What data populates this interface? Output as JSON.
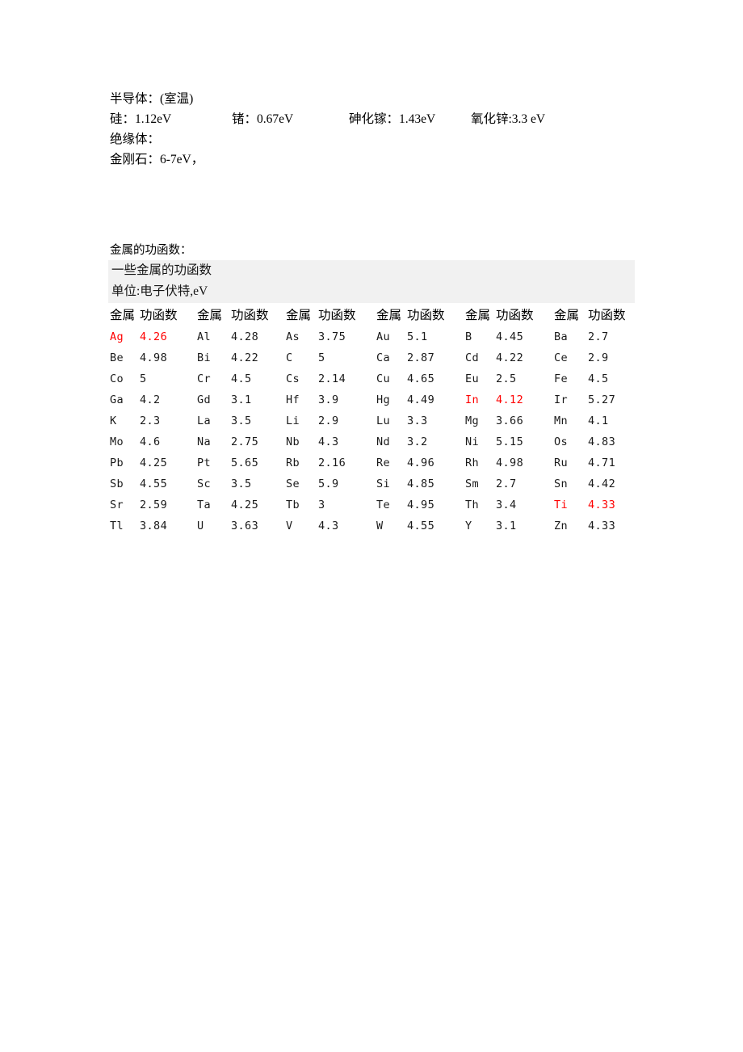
{
  "document": {
    "semiconductor": {
      "heading": "半导体：(室温)",
      "entries": [
        "硅：1.12eV",
        "锗：0.67eV",
        "砷化镓：1.43eV",
        "氧化锌:3.3 eV"
      ]
    },
    "insulator": {
      "heading": "绝缘体：",
      "entries": [
        "金刚石：6-7eV，"
      ]
    },
    "work_function_section": {
      "caption": "金属的功函数：",
      "band_title": "一些金属的功函数",
      "band_unit": "单位:电子伏特,eV",
      "header_metal": "金属",
      "header_value": "功函数",
      "highlight_color": "#ff0000",
      "band_background": "#f1f1f1",
      "rows": [
        [
          {
            "sym": "Ag",
            "val": "4.26",
            "hl": true
          },
          {
            "sym": "Al",
            "val": "4.28",
            "hl": false
          },
          {
            "sym": "As",
            "val": "3.75",
            "hl": false
          },
          {
            "sym": "Au",
            "val": "5.1",
            "hl": false
          },
          {
            "sym": "B",
            "val": "4.45",
            "hl": false
          },
          {
            "sym": "Ba",
            "val": "2.7",
            "hl": false
          }
        ],
        [
          {
            "sym": "Be",
            "val": "4.98",
            "hl": false
          },
          {
            "sym": "Bi",
            "val": "4.22",
            "hl": false
          },
          {
            "sym": "C",
            "val": "5",
            "hl": false
          },
          {
            "sym": "Ca",
            "val": "2.87",
            "hl": false
          },
          {
            "sym": "Cd",
            "val": "4.22",
            "hl": false
          },
          {
            "sym": "Ce",
            "val": "2.9",
            "hl": false
          }
        ],
        [
          {
            "sym": "Co",
            "val": "5",
            "hl": false
          },
          {
            "sym": "Cr",
            "val": "4.5",
            "hl": false
          },
          {
            "sym": "Cs",
            "val": "2.14",
            "hl": false
          },
          {
            "sym": "Cu",
            "val": "4.65",
            "hl": false
          },
          {
            "sym": "Eu",
            "val": "2.5",
            "hl": false
          },
          {
            "sym": "Fe",
            "val": "4.5",
            "hl": false
          }
        ],
        [
          {
            "sym": "Ga",
            "val": "4.2",
            "hl": false
          },
          {
            "sym": "Gd",
            "val": "3.1",
            "hl": false
          },
          {
            "sym": "Hf",
            "val": "3.9",
            "hl": false
          },
          {
            "sym": "Hg",
            "val": "4.49",
            "hl": false
          },
          {
            "sym": "In",
            "val": "4.12",
            "hl": true
          },
          {
            "sym": "Ir",
            "val": "5.27",
            "hl": false
          }
        ],
        [
          {
            "sym": "K",
            "val": "2.3",
            "hl": false
          },
          {
            "sym": "La",
            "val": "3.5",
            "hl": false
          },
          {
            "sym": "Li",
            "val": "2.9",
            "hl": false
          },
          {
            "sym": "Lu",
            "val": "3.3",
            "hl": false
          },
          {
            "sym": "Mg",
            "val": "3.66",
            "hl": false
          },
          {
            "sym": "Mn",
            "val": "4.1",
            "hl": false
          }
        ],
        [
          {
            "sym": "Mo",
            "val": "4.6",
            "hl": false
          },
          {
            "sym": "Na",
            "val": "2.75",
            "hl": false
          },
          {
            "sym": "Nb",
            "val": "4.3",
            "hl": false
          },
          {
            "sym": "Nd",
            "val": "3.2",
            "hl": false
          },
          {
            "sym": "Ni",
            "val": "5.15",
            "hl": false
          },
          {
            "sym": "Os",
            "val": "4.83",
            "hl": false
          }
        ],
        [
          {
            "sym": "Pb",
            "val": "4.25",
            "hl": false
          },
          {
            "sym": "Pt",
            "val": "5.65",
            "hl": false
          },
          {
            "sym": "Rb",
            "val": "2.16",
            "hl": false
          },
          {
            "sym": "Re",
            "val": "4.96",
            "hl": false
          },
          {
            "sym": "Rh",
            "val": "4.98",
            "hl": false
          },
          {
            "sym": "Ru",
            "val": "4.71",
            "hl": false
          }
        ],
        [
          {
            "sym": "Sb",
            "val": "4.55",
            "hl": false
          },
          {
            "sym": "Sc",
            "val": "3.5",
            "hl": false
          },
          {
            "sym": "Se",
            "val": "5.9",
            "hl": false
          },
          {
            "sym": "Si",
            "val": "4.85",
            "hl": false
          },
          {
            "sym": "Sm",
            "val": "2.7",
            "hl": false
          },
          {
            "sym": "Sn",
            "val": "4.42",
            "hl": false
          }
        ],
        [
          {
            "sym": "Sr",
            "val": "2.59",
            "hl": false
          },
          {
            "sym": "Ta",
            "val": "4.25",
            "hl": false
          },
          {
            "sym": "Tb",
            "val": "3",
            "hl": false
          },
          {
            "sym": "Te",
            "val": "4.95",
            "hl": false
          },
          {
            "sym": "Th",
            "val": "3.4",
            "hl": false
          },
          {
            "sym": "Ti",
            "val": "4.33",
            "hl": true
          }
        ],
        [
          {
            "sym": "Tl",
            "val": "3.84",
            "hl": false
          },
          {
            "sym": "U",
            "val": "3.63",
            "hl": false
          },
          {
            "sym": "V",
            "val": "4.3",
            "hl": false
          },
          {
            "sym": "W",
            "val": "4.55",
            "hl": false
          },
          {
            "sym": "Y",
            "val": "3.1",
            "hl": false
          },
          {
            "sym": "Zn",
            "val": "4.33",
            "hl": false
          }
        ]
      ]
    }
  }
}
